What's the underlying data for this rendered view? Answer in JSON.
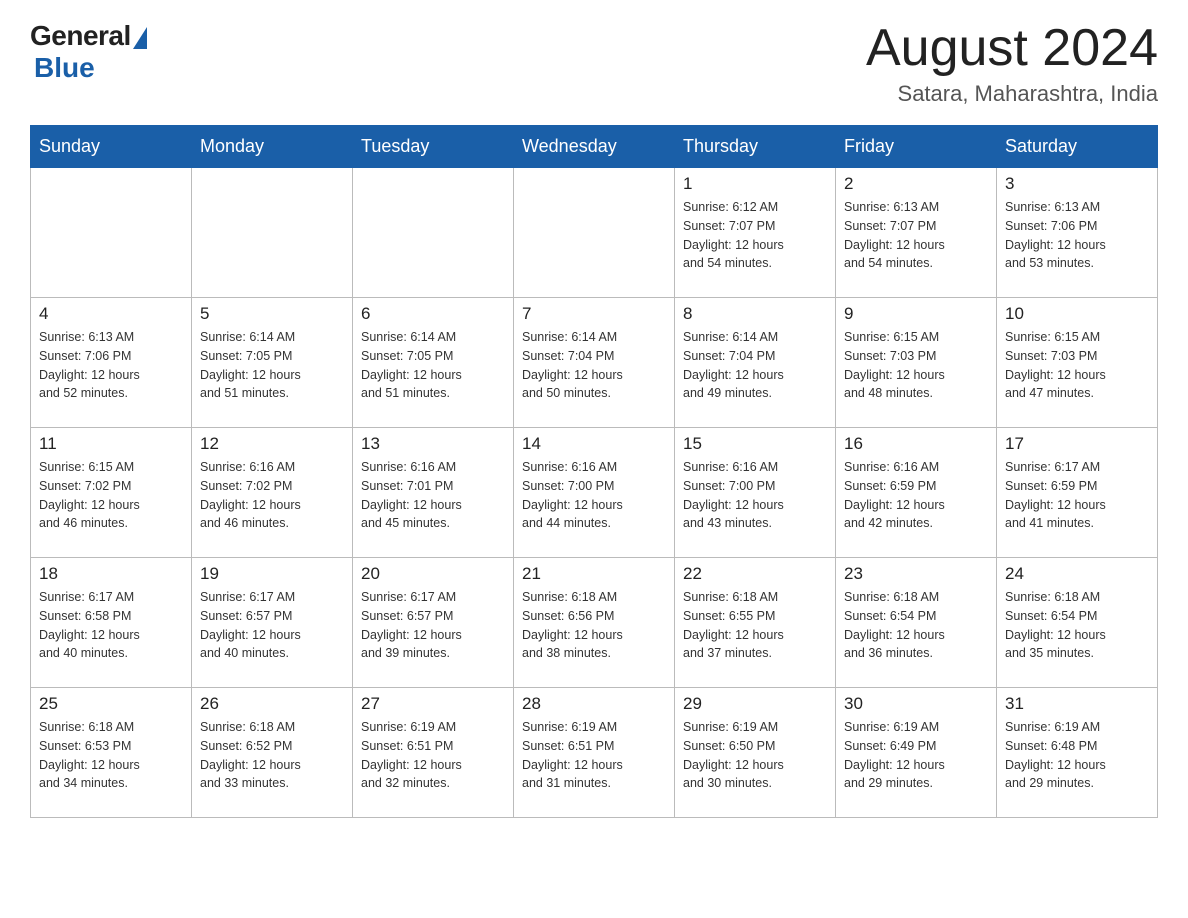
{
  "logo": {
    "general": "General",
    "triangle": "",
    "blue": "Blue"
  },
  "title": "August 2024",
  "subtitle": "Satara, Maharashtra, India",
  "weekdays": [
    "Sunday",
    "Monday",
    "Tuesday",
    "Wednesday",
    "Thursday",
    "Friday",
    "Saturday"
  ],
  "weeks": [
    [
      {
        "day": "",
        "info": ""
      },
      {
        "day": "",
        "info": ""
      },
      {
        "day": "",
        "info": ""
      },
      {
        "day": "",
        "info": ""
      },
      {
        "day": "1",
        "info": "Sunrise: 6:12 AM\nSunset: 7:07 PM\nDaylight: 12 hours\nand 54 minutes."
      },
      {
        "day": "2",
        "info": "Sunrise: 6:13 AM\nSunset: 7:07 PM\nDaylight: 12 hours\nand 54 minutes."
      },
      {
        "day": "3",
        "info": "Sunrise: 6:13 AM\nSunset: 7:06 PM\nDaylight: 12 hours\nand 53 minutes."
      }
    ],
    [
      {
        "day": "4",
        "info": "Sunrise: 6:13 AM\nSunset: 7:06 PM\nDaylight: 12 hours\nand 52 minutes."
      },
      {
        "day": "5",
        "info": "Sunrise: 6:14 AM\nSunset: 7:05 PM\nDaylight: 12 hours\nand 51 minutes."
      },
      {
        "day": "6",
        "info": "Sunrise: 6:14 AM\nSunset: 7:05 PM\nDaylight: 12 hours\nand 51 minutes."
      },
      {
        "day": "7",
        "info": "Sunrise: 6:14 AM\nSunset: 7:04 PM\nDaylight: 12 hours\nand 50 minutes."
      },
      {
        "day": "8",
        "info": "Sunrise: 6:14 AM\nSunset: 7:04 PM\nDaylight: 12 hours\nand 49 minutes."
      },
      {
        "day": "9",
        "info": "Sunrise: 6:15 AM\nSunset: 7:03 PM\nDaylight: 12 hours\nand 48 minutes."
      },
      {
        "day": "10",
        "info": "Sunrise: 6:15 AM\nSunset: 7:03 PM\nDaylight: 12 hours\nand 47 minutes."
      }
    ],
    [
      {
        "day": "11",
        "info": "Sunrise: 6:15 AM\nSunset: 7:02 PM\nDaylight: 12 hours\nand 46 minutes."
      },
      {
        "day": "12",
        "info": "Sunrise: 6:16 AM\nSunset: 7:02 PM\nDaylight: 12 hours\nand 46 minutes."
      },
      {
        "day": "13",
        "info": "Sunrise: 6:16 AM\nSunset: 7:01 PM\nDaylight: 12 hours\nand 45 minutes."
      },
      {
        "day": "14",
        "info": "Sunrise: 6:16 AM\nSunset: 7:00 PM\nDaylight: 12 hours\nand 44 minutes."
      },
      {
        "day": "15",
        "info": "Sunrise: 6:16 AM\nSunset: 7:00 PM\nDaylight: 12 hours\nand 43 minutes."
      },
      {
        "day": "16",
        "info": "Sunrise: 6:16 AM\nSunset: 6:59 PM\nDaylight: 12 hours\nand 42 minutes."
      },
      {
        "day": "17",
        "info": "Sunrise: 6:17 AM\nSunset: 6:59 PM\nDaylight: 12 hours\nand 41 minutes."
      }
    ],
    [
      {
        "day": "18",
        "info": "Sunrise: 6:17 AM\nSunset: 6:58 PM\nDaylight: 12 hours\nand 40 minutes."
      },
      {
        "day": "19",
        "info": "Sunrise: 6:17 AM\nSunset: 6:57 PM\nDaylight: 12 hours\nand 40 minutes."
      },
      {
        "day": "20",
        "info": "Sunrise: 6:17 AM\nSunset: 6:57 PM\nDaylight: 12 hours\nand 39 minutes."
      },
      {
        "day": "21",
        "info": "Sunrise: 6:18 AM\nSunset: 6:56 PM\nDaylight: 12 hours\nand 38 minutes."
      },
      {
        "day": "22",
        "info": "Sunrise: 6:18 AM\nSunset: 6:55 PM\nDaylight: 12 hours\nand 37 minutes."
      },
      {
        "day": "23",
        "info": "Sunrise: 6:18 AM\nSunset: 6:54 PM\nDaylight: 12 hours\nand 36 minutes."
      },
      {
        "day": "24",
        "info": "Sunrise: 6:18 AM\nSunset: 6:54 PM\nDaylight: 12 hours\nand 35 minutes."
      }
    ],
    [
      {
        "day": "25",
        "info": "Sunrise: 6:18 AM\nSunset: 6:53 PM\nDaylight: 12 hours\nand 34 minutes."
      },
      {
        "day": "26",
        "info": "Sunrise: 6:18 AM\nSunset: 6:52 PM\nDaylight: 12 hours\nand 33 minutes."
      },
      {
        "day": "27",
        "info": "Sunrise: 6:19 AM\nSunset: 6:51 PM\nDaylight: 12 hours\nand 32 minutes."
      },
      {
        "day": "28",
        "info": "Sunrise: 6:19 AM\nSunset: 6:51 PM\nDaylight: 12 hours\nand 31 minutes."
      },
      {
        "day": "29",
        "info": "Sunrise: 6:19 AM\nSunset: 6:50 PM\nDaylight: 12 hours\nand 30 minutes."
      },
      {
        "day": "30",
        "info": "Sunrise: 6:19 AM\nSunset: 6:49 PM\nDaylight: 12 hours\nand 29 minutes."
      },
      {
        "day": "31",
        "info": "Sunrise: 6:19 AM\nSunset: 6:48 PM\nDaylight: 12 hours\nand 29 minutes."
      }
    ]
  ]
}
